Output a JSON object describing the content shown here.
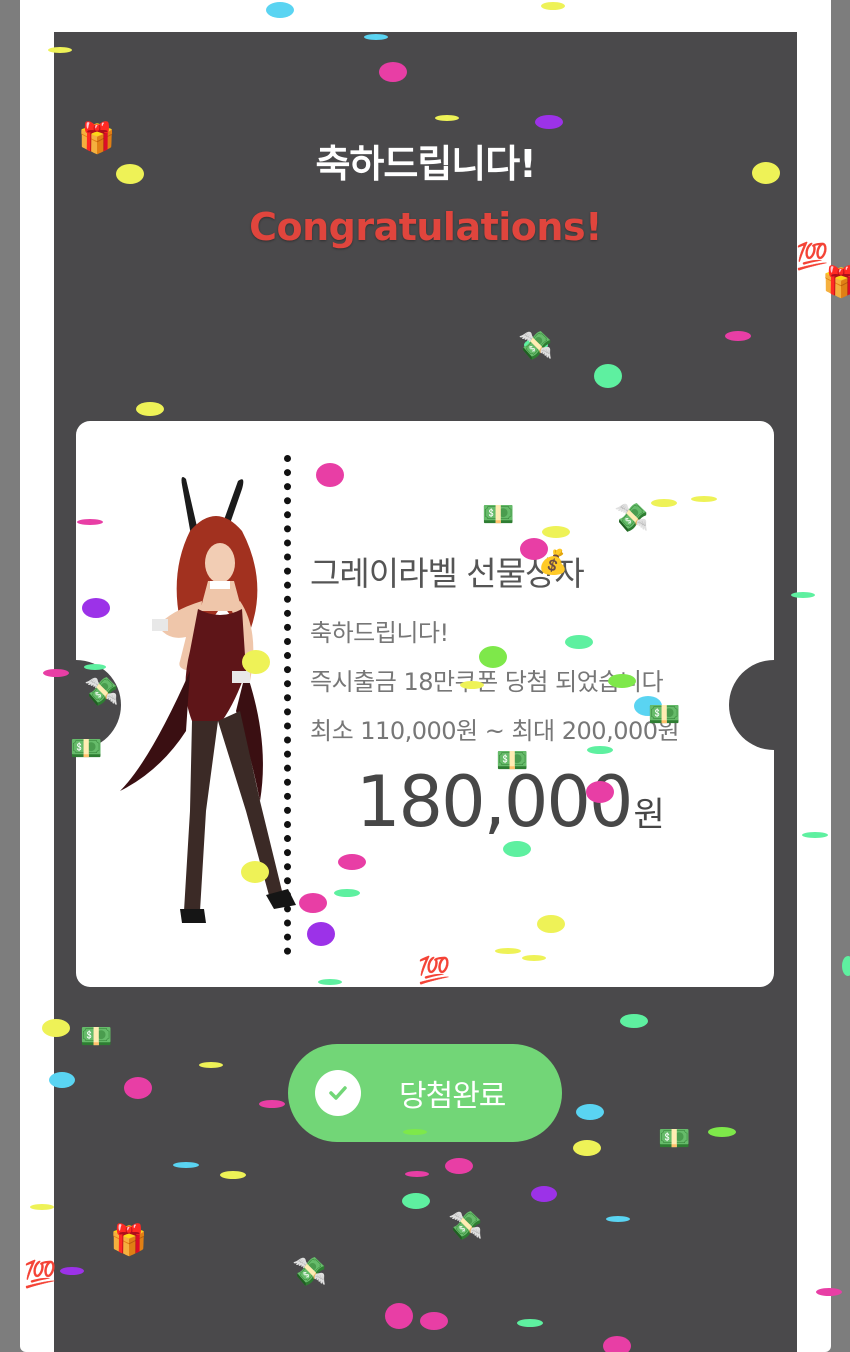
{
  "header": {
    "title_ko": "축하드립니다!",
    "title_en": "Congratulations!"
  },
  "ticket": {
    "title": "그레이라벨 선물상자",
    "line1": "축하드립니다!",
    "line2": "즉시출금 18만쿠폰 당첨 되었습니다",
    "line3": "최소 110,000원 ~ 최대 200,000원",
    "amount": "180,000",
    "amount_unit": "원"
  },
  "button": {
    "label": "당첨완료",
    "icon": "check-icon"
  },
  "colors": {
    "dark_background": "#4a494b",
    "heading_red": "#e0453d",
    "button_green": "#72d677"
  }
}
